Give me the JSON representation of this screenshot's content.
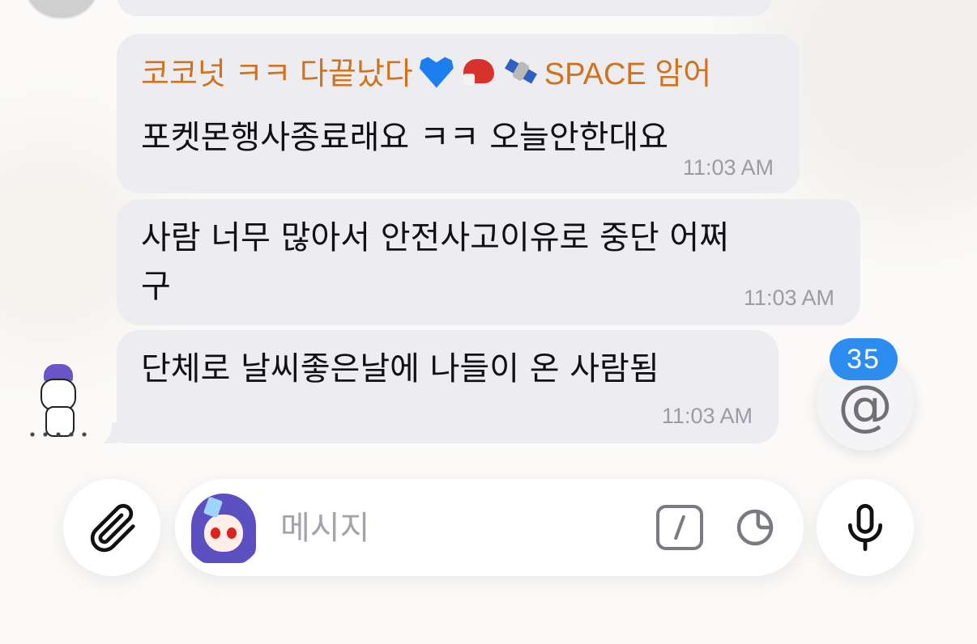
{
  "messages": [
    {
      "sender": "코코넛 ㅋㅋ 다끝났다",
      "sender_suffix": "SPACE 암어",
      "sender_emojis": [
        "blue-heart-icon",
        "boxing-glove-icon",
        "satellite-icon"
      ],
      "text": "포켓몬행사종료래요 ㅋㅋ 오늘안한대요",
      "time": "11:03 AM"
    },
    {
      "text_line1": "사람 너무 많아서 안전사고이유로 중단 어쩌",
      "text_line2": "구",
      "time": "11:03 AM"
    },
    {
      "text": "단체로 날씨좋은날에 나들이 온 사람됨",
      "time": "11:03 AM"
    }
  ],
  "mention": {
    "count": "35",
    "icon": "at-sign-icon"
  },
  "composer": {
    "placeholder": "메시지",
    "value": ""
  },
  "colors": {
    "bubble": "#ececf1",
    "sender_name": "#d0731f",
    "badge": "#2d8cf0",
    "timestamp": "#9b9ba3",
    "icon": "#6f6f77"
  }
}
